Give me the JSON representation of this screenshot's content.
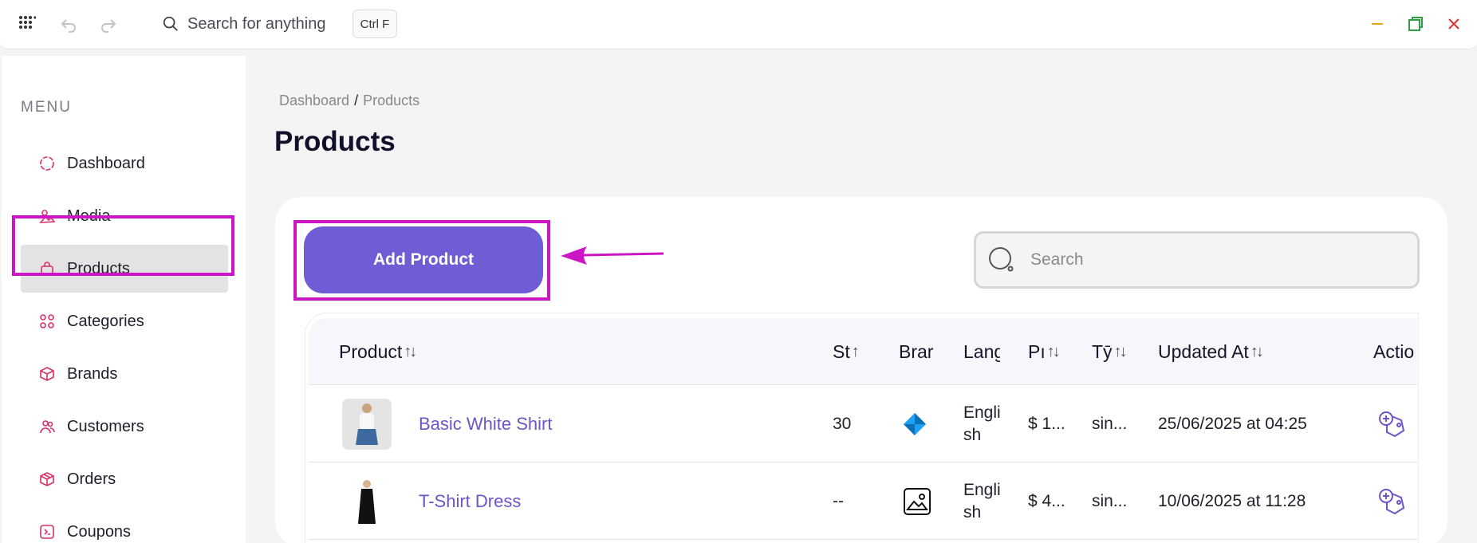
{
  "topbar": {
    "search_label": "Search for anything",
    "shortcut": "Ctrl F"
  },
  "sidebar": {
    "menu_title": "MENU",
    "items": [
      {
        "label": "Dashboard",
        "icon": "dashboard-icon"
      },
      {
        "label": "Media",
        "icon": "media-icon"
      },
      {
        "label": "Products",
        "icon": "shopping-bag-icon",
        "active": true
      },
      {
        "label": "Categories",
        "icon": "categories-icon"
      },
      {
        "label": "Brands",
        "icon": "cube-icon"
      },
      {
        "label": "Customers",
        "icon": "users-icon"
      },
      {
        "label": "Orders",
        "icon": "box-icon"
      },
      {
        "label": "Coupons",
        "icon": "coupon-icon"
      }
    ]
  },
  "breadcrumb": {
    "root": "Dashboard",
    "separator": "/",
    "current": "Products"
  },
  "page": {
    "title": "Products",
    "add_button": "Add Product",
    "search_placeholder": "Search"
  },
  "table": {
    "columns": [
      "Product",
      "St",
      "Brar",
      "Lang",
      "Pı",
      "Tȳ",
      "Updated At",
      "Actio"
    ],
    "rows": [
      {
        "product": "Basic White Shirt",
        "stock": "30",
        "brand_icon": "diamond-logo-icon",
        "language": "English",
        "price": "$ 1...",
        "type": "sin...",
        "updated_at": "25/06/2025 at 04:25"
      },
      {
        "product": "T-Shirt Dress",
        "stock": "--",
        "brand_icon": "image-placeholder-icon",
        "language": "English",
        "price": "$ 4...",
        "type": "sin...",
        "updated_at": "10/06/2025 at 11:28"
      }
    ]
  },
  "colors": {
    "accent": "#6e5dd4",
    "highlight": "#cc16c6",
    "link": "#6b55c8"
  }
}
